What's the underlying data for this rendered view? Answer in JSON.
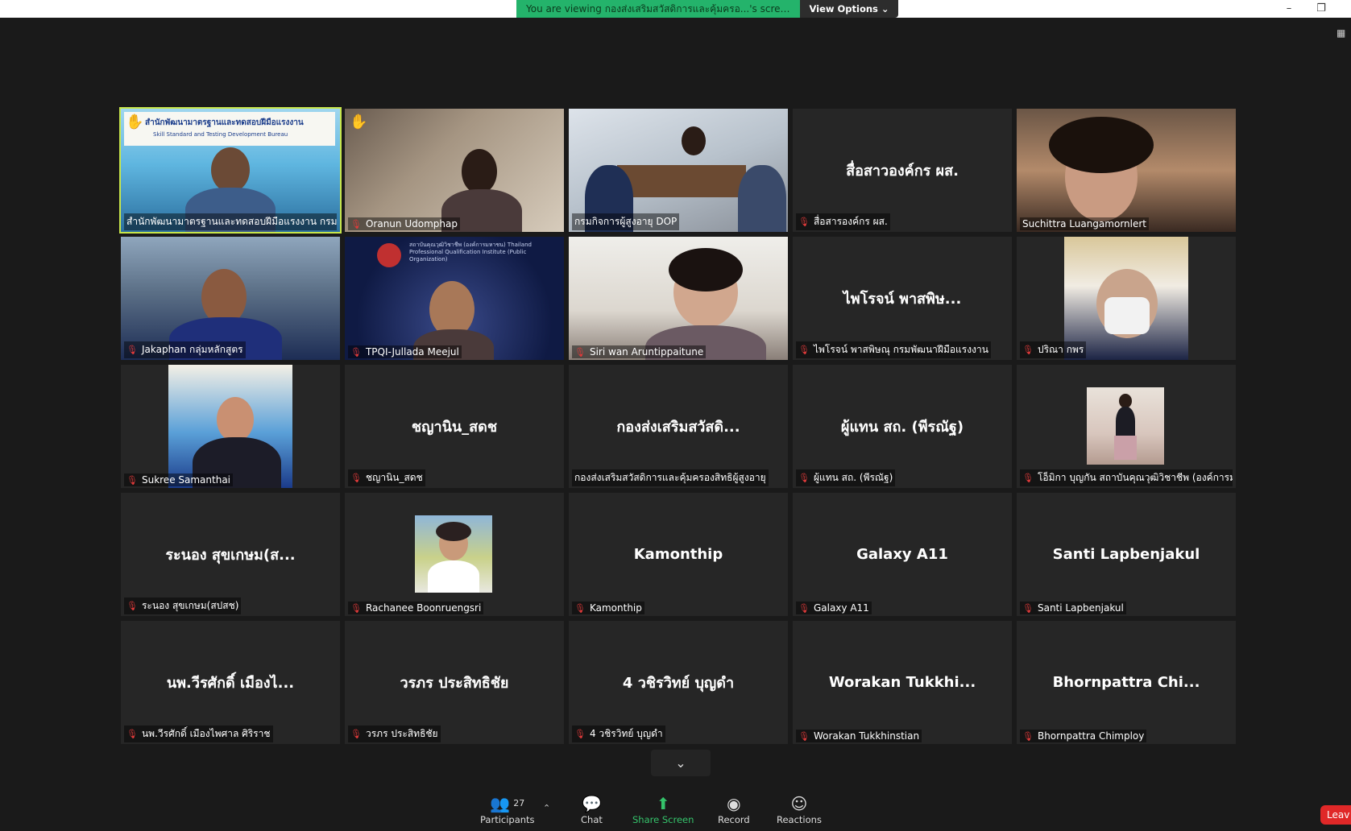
{
  "banner": {
    "text": "You are viewing กองส่งเสริมสวัสดิการและคุ้มครอ...'s screen",
    "view_options": "View Options ⌄"
  },
  "window": {
    "minimize": "–",
    "restore": "❐"
  },
  "tiles": [
    {
      "label": "สำนักพัฒนามาตรฐานและทดสอบฝีมือแรงงาน กรมพัฒ...",
      "big": ""
    },
    {
      "label": "Oranun Udomphap",
      "big": ""
    },
    {
      "label": "กรมกิจการผู้สูงอายุ DOP",
      "big": ""
    },
    {
      "label": "สื่อสารองค์กร ผส.",
      "big": "สื่อสาวองค์กร ผส."
    },
    {
      "label": "Suchittra Luangamornlert",
      "big": ""
    },
    {
      "label": "Jakaphan กลุ่มหลักสูตร",
      "big": ""
    },
    {
      "label": "TPQI-Jullada Meejul",
      "big": ""
    },
    {
      "label": "Siri wan Aruntippaitune",
      "big": ""
    },
    {
      "label": "ไพโรจน์ พาสพิษณุ กรมพัฒนาฝีมือแรงงาน",
      "big": "ไพโรจน์ พาสพิษ..."
    },
    {
      "label": "ปริณา กพร",
      "big": ""
    },
    {
      "label": "Sukree Samanthai",
      "big": ""
    },
    {
      "label": "ชญานิน_สดช",
      "big": "ชญานิน_สดช"
    },
    {
      "label": "กองส่งเสริมสวัสดิการและคุ้มครองสิทธิผู้สูงอายุ",
      "big": "กองส่งเสริมสวัสดิ..."
    },
    {
      "label": "ผู้แทน สถ. (พีรณัฐ)",
      "big": "ผู้แทน สถ. (พีรณัฐ)"
    },
    {
      "label": "โอ็มิกา บุญกัน สถาบันคุณวุฒิวิชาชีพ (องค์การม...",
      "big": ""
    },
    {
      "label": "ระนอง สุขเกษม(สปสช)",
      "big": "ระนอง สุขเกษม(ส..."
    },
    {
      "label": "Rachanee Boonruengsri",
      "big": ""
    },
    {
      "label": "Kamonthip",
      "big": "Kamonthip"
    },
    {
      "label": "Galaxy A11",
      "big": "Galaxy A11"
    },
    {
      "label": "Santi Lapbenjakul",
      "big": "Santi Lapbenjakul"
    },
    {
      "label": "นพ.วีรศักดิ์ เมืองไพศาล ศิริราช",
      "big": "นพ.วีรศักดิ์ เมืองไ..."
    },
    {
      "label": "วรภร ประสิทธิชัย",
      "big": "วรภร ประสิทธิชัย"
    },
    {
      "label": "4 วชิรวิทย์ บุญดำ",
      "big": "4 วชิรวิทย์ บุญดำ"
    },
    {
      "label": "Worakan Tukkhinstian",
      "big": "Worakan Tukkhi..."
    },
    {
      "label": "Bhornpattra Chimploy",
      "big": "Bhornpattra Chi..."
    }
  ],
  "slide": {
    "title_th": "สำนักพัฒนามาตรฐานและทดสอบฝีมือแรงงาน",
    "title_en": "Skill Standard and Testing Development Bureau"
  },
  "tpqi_banner": "สถาบันคุณวุฒิวิชาชีพ (องค์การมหาชน) Thailand Professional Qualification Institute (Public Organization)",
  "toolbar": {
    "participants_count": "27",
    "participants": "Participants",
    "chat": "Chat",
    "share": "Share Screen",
    "record": "Record",
    "reactions": "Reactions",
    "leave": "Leav"
  },
  "colors": {
    "accent_green": "#24b36b",
    "active_border": "#c8e64a",
    "leave_red": "#e02828"
  }
}
